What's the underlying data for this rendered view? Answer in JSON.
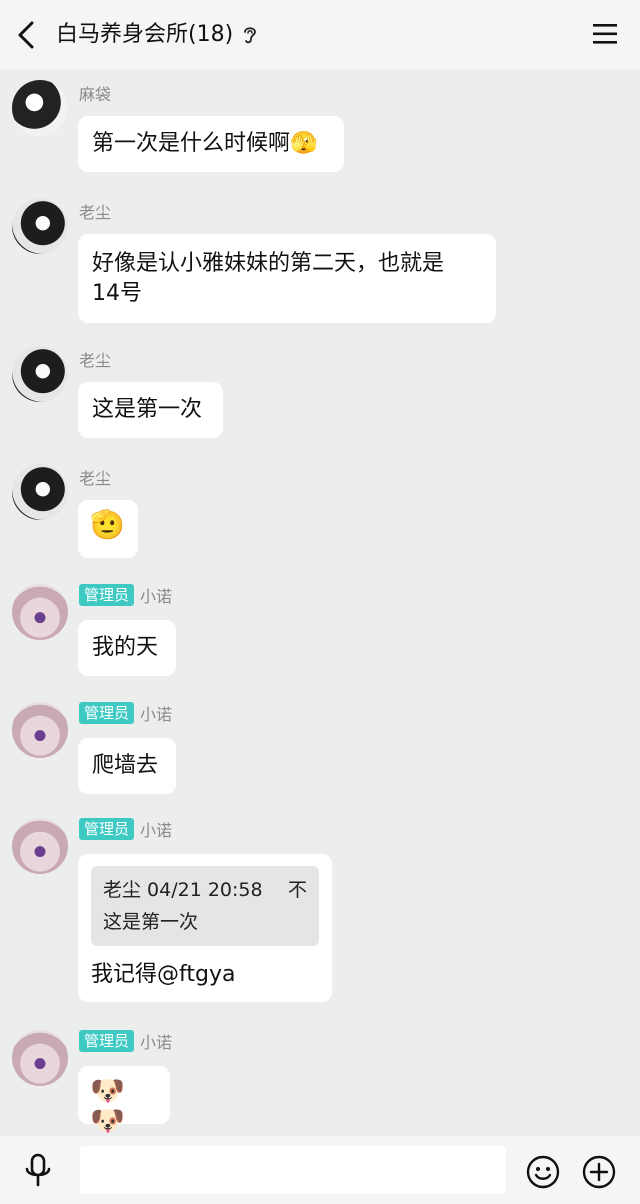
{
  "header": {
    "title": "白马养身会所(18)",
    "back_icon": "chevron-left-icon",
    "ear_icon": "ear-icon",
    "menu_icon": "hamburger-menu-icon"
  },
  "messages": [
    {
      "sender": "麻袋",
      "text": "第一次是什么时候啊🫣"
    },
    {
      "sender": "老尘",
      "text_line1": "好像是认小雅妹妹的第二天，也就是",
      "text_line2": "14号"
    },
    {
      "sender": "老尘",
      "text": "这是第一次"
    },
    {
      "sender": "老尘",
      "text": "🫡"
    },
    {
      "badge": "管理员",
      "sender": "小诺",
      "text": "我的天"
    },
    {
      "badge": "管理员",
      "sender": "小诺",
      "text": "爬墙去"
    },
    {
      "badge": "管理员",
      "sender": "小诺",
      "quote_header": "老尘 04/21 20:58",
      "quote_mark": "不",
      "quote_text": "这是第一次",
      "text": "我记得@ftgya"
    },
    {
      "badge": "管理员",
      "sender": "小诺",
      "text": "🐶🐶"
    }
  ],
  "composer": {
    "input_value": "",
    "mic_icon": "microphone-icon",
    "emoji_icon": "smiley-icon",
    "plus_icon": "plus-circle-icon"
  },
  "colors": {
    "badge": "#3ec9c2",
    "background": "#eceeed"
  }
}
